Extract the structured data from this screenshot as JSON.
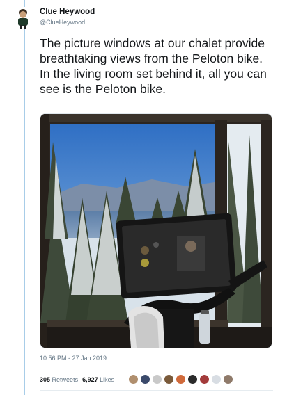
{
  "author": {
    "display_name": "Clue Heywood",
    "handle": "@ClueHeywood"
  },
  "tweet": {
    "text": "The picture windows at our chalet provide breathtaking views from the Peloton bike. In the living room set behind it, all you can see is the Peloton bike.",
    "timestamp": "10:56 PM - 27 Jan 2019"
  },
  "stats": {
    "retweets_count": "305",
    "retweets_label": "Retweets",
    "likes_count": "6,927",
    "likes_label": "Likes"
  },
  "likers": [
    {
      "icon": "liker-avatar",
      "color": "#b08f6e"
    },
    {
      "icon": "liker-avatar",
      "color": "#3b4a6b"
    },
    {
      "icon": "liker-avatar",
      "color": "#c9c9c9"
    },
    {
      "icon": "liker-avatar",
      "color": "#7a5a3a"
    },
    {
      "icon": "liker-avatar",
      "color": "#d06a3b"
    },
    {
      "icon": "liker-avatar",
      "color": "#2b2b2b"
    },
    {
      "icon": "liker-avatar",
      "color": "#a33b3b"
    },
    {
      "icon": "liker-avatar",
      "color": "#d8dde3"
    },
    {
      "icon": "liker-avatar",
      "color": "#8f7a6a"
    }
  ],
  "colors": {
    "text_primary": "#14171a",
    "text_secondary": "#657786",
    "thread_line": "#a8cde8",
    "divider": "#e6ecf0"
  }
}
